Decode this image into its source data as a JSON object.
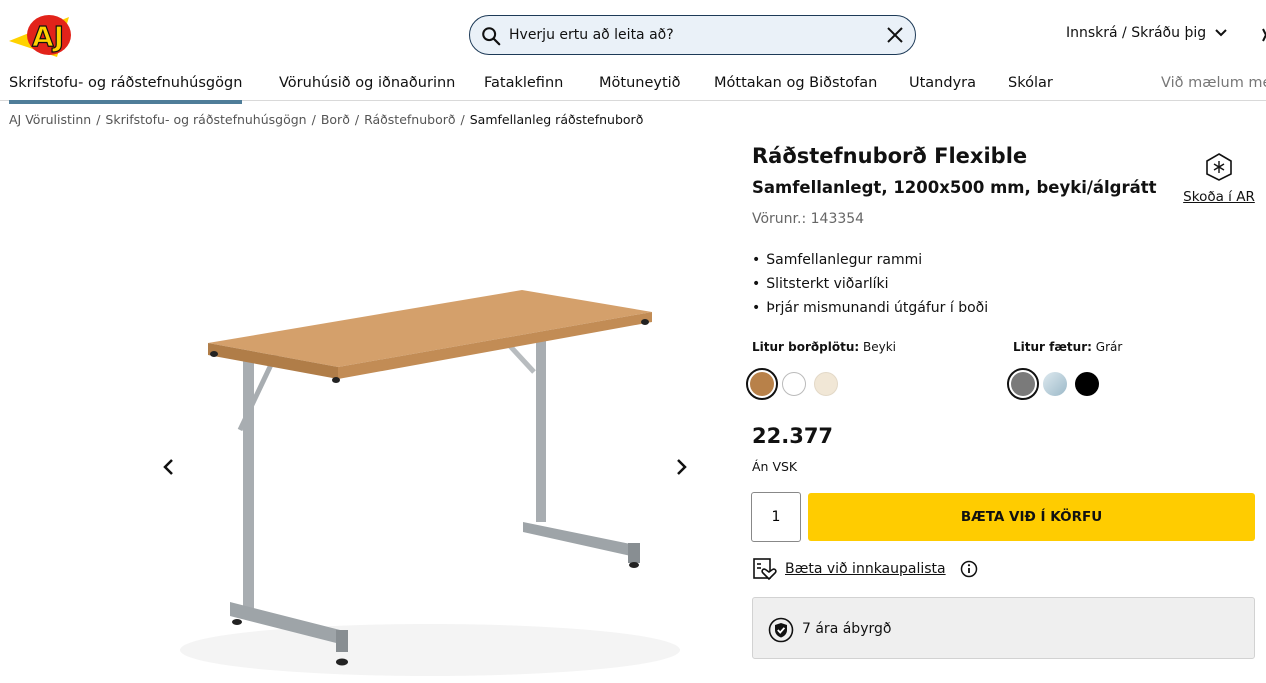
{
  "header": {
    "logo_text": "AJ",
    "search_placeholder": "Hverju ertu að leita að?",
    "login_label": "Innskrá / Skráðu þig"
  },
  "nav": {
    "items": [
      "Skrifstofu- og ráðstefnuhúsgögn",
      "Vöruhúsið og iðnaðurinn",
      "Fataklefinn",
      "Mötuneytið",
      "Móttakan og Biðstofan",
      "Utandyra",
      "Skólar",
      "Við mælum me"
    ],
    "active_index": 0
  },
  "breadcrumb": {
    "items": [
      "AJ Vörulistinn",
      "Skrifstofu- og ráðstefnuhúsgögn",
      "Borð",
      "Ráðstefnuborð"
    ],
    "current": "Samfellanleg ráðstefnuborð",
    "separator": "/"
  },
  "product": {
    "title": "Ráðstefnuborð Flexible",
    "subtitle": "Samfellanlegt, 1200x500 mm, beyki/álgrátt",
    "sku": "Vörunr.: 143354",
    "ar_label": "Skoða í AR",
    "features": [
      "Samfellanlegur rammi",
      "Slitsterkt viðarlíki",
      "Þrjár mismunandi útgáfur í boði"
    ],
    "top_color": {
      "label": "Litur borðplötu:",
      "value": "Beyki",
      "swatches": [
        "#b88149",
        "#ffffff",
        "#f1e7d6"
      ],
      "selected_index": 0
    },
    "leg_color": {
      "label": "Litur fætur:",
      "value": "Grár",
      "swatches": [
        "#7a7a7a",
        "#b5cfdc",
        "#000000"
      ],
      "selected_index": 0
    },
    "price": "22.377",
    "vat_note": "Án VSK",
    "quantity": "1",
    "add_to_cart": "BÆTA VIÐ Í KÖRFU",
    "wishlist_label": "Bæta við innkaupalista",
    "warranty": "7 ára ábyrgð"
  },
  "colors": {
    "accent_nav": "#4f7d99",
    "cart_button": "#ffcc00",
    "logo_red": "#e2231a",
    "logo_yellow": "#ffd200"
  }
}
